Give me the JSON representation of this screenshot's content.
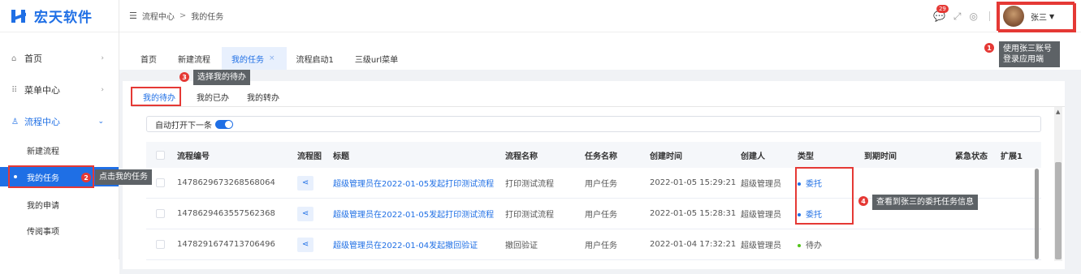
{
  "app": {
    "name": "宏天软件"
  },
  "sidebar": {
    "items": [
      {
        "label": "首页",
        "icon": "home-icon"
      },
      {
        "label": "菜单中心",
        "icon": "grid-icon"
      },
      {
        "label": "流程中心",
        "icon": "flow-icon",
        "expanded": true
      }
    ],
    "subitems": [
      {
        "label": "新建流程"
      },
      {
        "label": "我的任务",
        "active": true
      },
      {
        "label": "我的申请"
      },
      {
        "label": "传阅事项"
      }
    ]
  },
  "header": {
    "breadcrumb": [
      "流程中心",
      "我的任务"
    ],
    "breadcrumb_sep": ">",
    "message_badge": "29",
    "username": "张三"
  },
  "tabs": [
    {
      "label": "首页"
    },
    {
      "label": "新建流程"
    },
    {
      "label": "我的任务",
      "active": true,
      "close": "×"
    },
    {
      "label": "流程启动1"
    },
    {
      "label": "三级url菜单"
    }
  ],
  "subtabs": [
    {
      "label": "我的待办",
      "active": true
    },
    {
      "label": "我的已办"
    },
    {
      "label": "我的转办"
    }
  ],
  "auto_open": {
    "label": "自动打开下一条",
    "enabled": true
  },
  "table": {
    "columns": [
      "流程编号",
      "流程图",
      "标题",
      "流程名称",
      "任务名称",
      "创建时间",
      "创建人",
      "类型",
      "到期时间",
      "紧急状态",
      "扩展1"
    ],
    "rows": [
      {
        "id": "1478629673268568064",
        "title": "超级管理员在2022-01-05发起打印测试流程",
        "process": "打印测试流程",
        "task": "用户任务",
        "created": "2022-01-05 15:29:21",
        "creator": "超级管理员",
        "type": "委托",
        "type_color": "#1f6fe5"
      },
      {
        "id": "1478629463557562368",
        "title": "超级管理员在2022-01-05发起打印测试流程",
        "process": "打印测试流程",
        "task": "用户任务",
        "created": "2022-01-05 15:28:31",
        "creator": "超级管理员",
        "type": "委托",
        "type_color": "#1f6fe5"
      },
      {
        "id": "1478291674713706496",
        "title": "超级管理员在2022-01-04发起撤回验证",
        "process": "撤回验证",
        "task": "用户任务",
        "created": "2022-01-04 17:32:21",
        "creator": "超级管理员",
        "type": "待办",
        "type_color": "#52c41a"
      }
    ]
  },
  "annotations": [
    {
      "num": "1",
      "text": "使用张三账号登录应用端"
    },
    {
      "num": "2",
      "text": "点击我的任务"
    },
    {
      "num": "3",
      "text": "选择我的待办"
    },
    {
      "num": "4",
      "text": "查看到张三的委托任务信息"
    }
  ],
  "colors": {
    "accent": "#1f6fe5",
    "annotation_red": "#e53935"
  }
}
